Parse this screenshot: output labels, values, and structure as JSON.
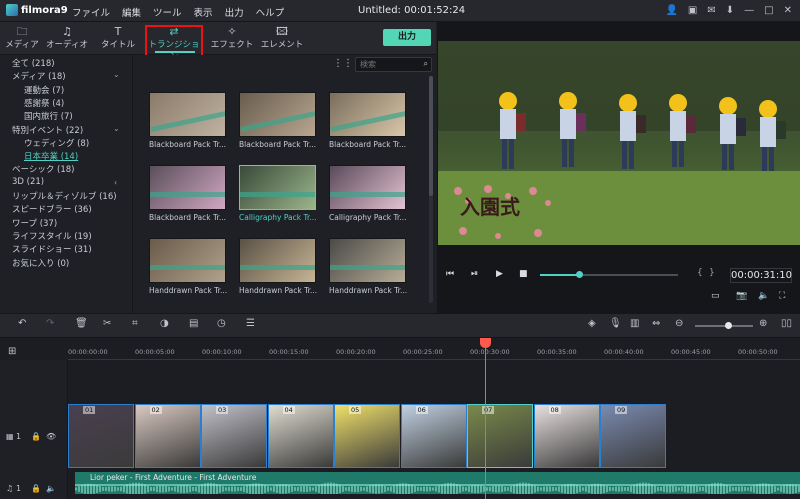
{
  "app": {
    "name": "filmora9",
    "title": "Untitled:  00:01:52:24"
  },
  "menu": [
    "ファイル",
    "編集",
    "ツール",
    "表示",
    "出力",
    "ヘルプ"
  ],
  "tabs": [
    {
      "label": "メディア",
      "icon": "folder-icon"
    },
    {
      "label": "オーディオ",
      "icon": "music-note-icon"
    },
    {
      "label": "タイトル",
      "icon": "title-icon"
    },
    {
      "label": "トランジション",
      "icon": "transition-icon"
    },
    {
      "label": "エフェクト",
      "icon": "effect-icon"
    },
    {
      "label": "エレメント",
      "icon": "element-icon"
    }
  ],
  "export_label": "出力",
  "search_placeholder": "検索",
  "sidebar": [
    {
      "label": "全て (218)",
      "indent": 0,
      "chev": ""
    },
    {
      "label": "メディア (18)",
      "indent": 0,
      "chev": "⌄"
    },
    {
      "label": "運動会 (7)",
      "indent": 1,
      "chev": ""
    },
    {
      "label": "感謝祭 (4)",
      "indent": 1,
      "chev": ""
    },
    {
      "label": "国内旅行 (7)",
      "indent": 1,
      "chev": ""
    },
    {
      "label": "特別イベント (22)",
      "indent": 0,
      "chev": "⌄"
    },
    {
      "label": "ウェディング (8)",
      "indent": 1,
      "chev": ""
    },
    {
      "label": "日本卒業 (14)",
      "indent": 1,
      "chev": "",
      "selected": true
    },
    {
      "label": "ベーシック (18)",
      "indent": 0,
      "chev": ""
    },
    {
      "label": "3D (21)",
      "indent": 0,
      "chev": ""
    },
    {
      "label": "リップル＆ディゾルブ (16)",
      "indent": 0,
      "chev": ""
    },
    {
      "label": "スピードブラー (36)",
      "indent": 0,
      "chev": ""
    },
    {
      "label": "ワープ (37)",
      "indent": 0,
      "chev": ""
    },
    {
      "label": "ライフスタイル (19)",
      "indent": 0,
      "chev": ""
    },
    {
      "label": "スライドショー (31)",
      "indent": 0,
      "chev": ""
    },
    {
      "label": "お気に入り (0)",
      "indent": 0,
      "chev": ""
    }
  ],
  "transitions": [
    {
      "label": "Blackboard Pack Tr..."
    },
    {
      "label": "Blackboard Pack Tr..."
    },
    {
      "label": "Blackboard Pack Tr..."
    },
    {
      "label": "Blackboard Pack Tr..."
    },
    {
      "label": "Calligraphy Pack Tr...",
      "selected": true
    },
    {
      "label": "Calligraphy Pack Tr..."
    },
    {
      "label": "Handdrawn Pack Tr..."
    },
    {
      "label": "Handdrawn Pack Tr..."
    },
    {
      "label": "Handdrawn Pack Tr..."
    }
  ],
  "preview": {
    "overlay_text": "入園式",
    "timecode": "00:00:31:10",
    "progress": 0.28
  },
  "ruler_ticks": [
    "00:00:00:00",
    "00:00:05:00",
    "00:00:10:00",
    "00:00:15:00",
    "00:00:20:00",
    "00:00:25:00",
    "00:00:30:00",
    "00:00:35:00",
    "00:00:40:00",
    "00:00:45:00",
    "00:00:50:00"
  ],
  "clips": [
    "01",
    "02",
    "03",
    "04",
    "05",
    "06",
    "07",
    "08",
    "09"
  ],
  "tracks": {
    "video": "1",
    "audio": "1"
  },
  "audio": {
    "label": "Lior peker - First Adventure - First Adventure"
  },
  "colors": {
    "accent": "#4fd1c5",
    "export": "#52d6b6",
    "playhead": "#ff5a4e",
    "audio": "#1f7a6a",
    "highlight_box": "#ee1111"
  }
}
